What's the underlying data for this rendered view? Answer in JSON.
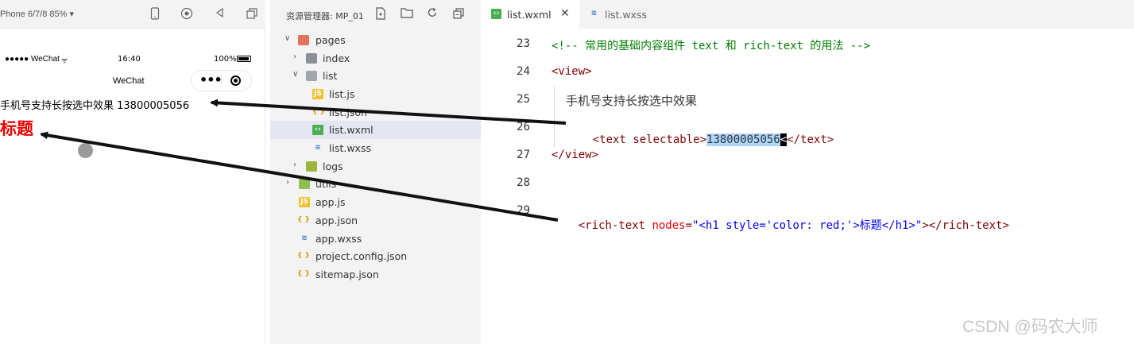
{
  "simulator": {
    "device_label": "Phone 6/7/8 85% ▾",
    "status_left": "●●●●● WeChat",
    "status_time": "16:40",
    "status_battery": "100%",
    "nav_title": "WeChat",
    "page_text": "手机号支持长按选中效果 13800005056",
    "page_heading": "标题"
  },
  "explorer": {
    "title": "资源管理器: MP_01",
    "tree": [
      {
        "label": "pages",
        "icon": "folder-red-icon",
        "expanded": true
      },
      {
        "label": "index",
        "icon": "folder-icon",
        "expanded": false
      },
      {
        "label": "list",
        "icon": "folder-open-icon",
        "expanded": true
      },
      {
        "label": "list.js",
        "icon": "js-file-icon"
      },
      {
        "label": "list.json",
        "icon": "json-file-icon"
      },
      {
        "label": "list.wxml",
        "icon": "wxml-file-icon",
        "selected": true
      },
      {
        "label": "list.wxss",
        "icon": "wxss-file-icon"
      },
      {
        "label": "logs",
        "icon": "logs-folder-icon",
        "expanded": false
      },
      {
        "label": "utils",
        "icon": "utils-folder-icon",
        "expanded": false
      },
      {
        "label": "app.js",
        "icon": "js-file-icon"
      },
      {
        "label": "app.json",
        "icon": "json-file-icon"
      },
      {
        "label": "app.wxss",
        "icon": "wxss-file-icon"
      },
      {
        "label": "project.config.json",
        "icon": "json-file-icon"
      },
      {
        "label": "sitemap.json",
        "icon": "json-file-icon"
      }
    ]
  },
  "editor": {
    "tabs": [
      {
        "label": "list.wxml",
        "active": true,
        "close": "✕"
      },
      {
        "label": "list.wxss",
        "active": false
      }
    ],
    "lines": [
      {
        "num": "23"
      },
      {
        "num": "24"
      },
      {
        "num": "25"
      },
      {
        "num": "26"
      },
      {
        "num": "27"
      },
      {
        "num": "28"
      },
      {
        "num": "29"
      }
    ],
    "code": {
      "l23": "<!-- 常用的基础内容组件 text 和 rich-text 的用法 -->",
      "l24": "<view>",
      "l25": "手机号支持长按选中效果",
      "l26_open": "<text selectable>",
      "l26_sel": "13800005056",
      "l26_close": "</text>",
      "l27": "</view>",
      "l29_tag": "<rich-text ",
      "l29_attr": "nodes",
      "l29_eq": "=",
      "l29_str": "\"<h1 style='color: red;'>标题</h1>\"",
      "l29_end": "></rich-text>"
    }
  },
  "watermark": "CSDN @码农大师",
  "colors": {
    "comment": "#008000",
    "tag": "#800000",
    "attr": "#e50000",
    "string": "#0000ff",
    "heading": "#e00000",
    "selection": "#add6ff"
  }
}
